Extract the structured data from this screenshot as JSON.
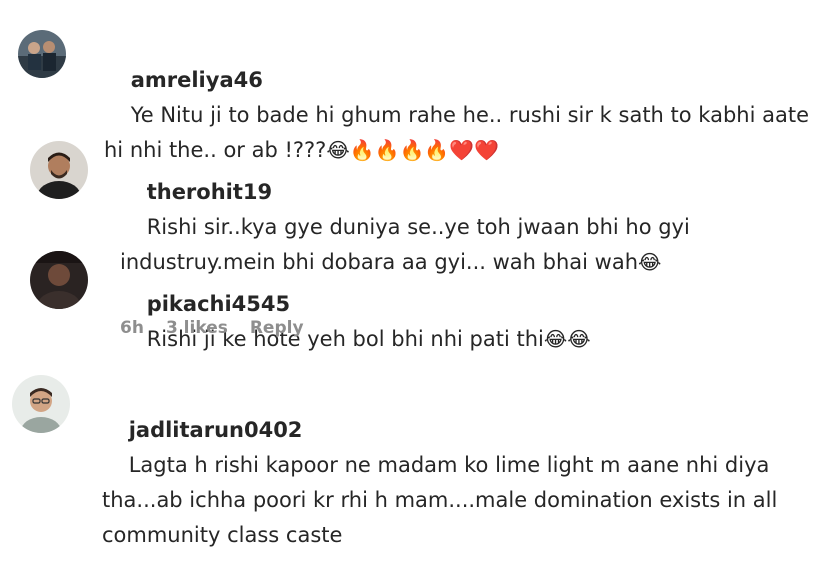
{
  "comments": [
    {
      "username": "amreliya46",
      "text": "Ye Nitu ji to bade hi ghum rahe he.. rushi sir k sath to kabhi aate hi nhi the.. or ab !???",
      "emojis": "😂🔥🔥🔥🔥❤️❤️"
    },
    {
      "username": "therohit19",
      "text": "Rishi sir..kya gye duniya se..ye toh jwaan bhi ho gyi industruy.mein bhi dobara aa gyi... wah bhai wah",
      "emojis": "😂"
    },
    {
      "username": "pikachi4545",
      "text": "Rishi ji ke hote yeh bol bhi nhi pati thi",
      "emojis": "😂😂",
      "meta": {
        "time": "6h",
        "likes": "3 likes",
        "reply": "Reply"
      }
    },
    {
      "username": "jadlitarun0402",
      "text": "Lagta h rishi kapoor ne madam ko lime light m aane nhi diya tha...ab ichha poori kr rhi h mam....male domination exists in all community class caste",
      "emojis": ""
    }
  ]
}
